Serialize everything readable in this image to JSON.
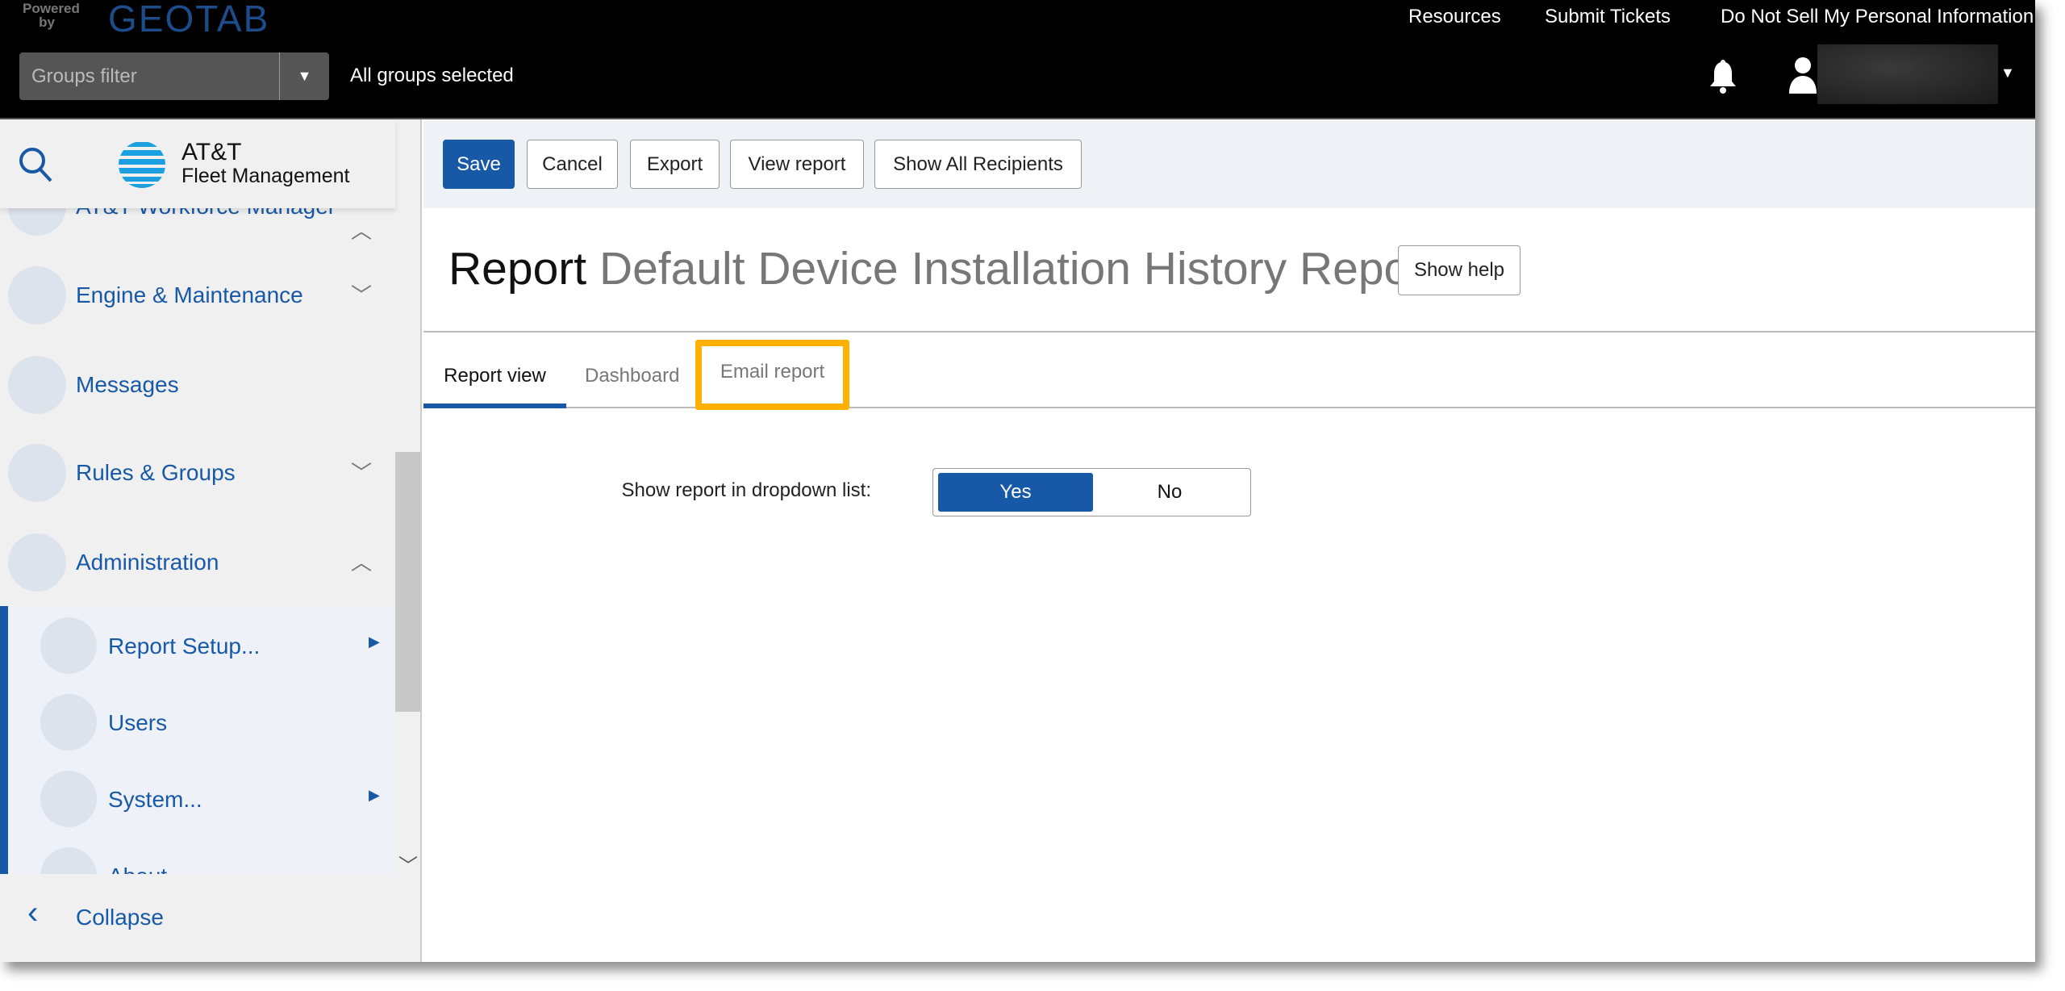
{
  "header": {
    "powered_by": "Powered by",
    "brand": "GEOTAB",
    "groups_filter_placeholder": "Groups filter",
    "groups_status": "All groups selected",
    "links": [
      "Resources",
      "Submit Tickets",
      "Do Not Sell My Personal Information"
    ]
  },
  "sidebar": {
    "logo_line1": "AT&T",
    "logo_line2": "Fleet Management",
    "items": [
      {
        "label": "AT&T Workforce Manager",
        "icon": "workforce-icon"
      },
      {
        "label": "Engine & Maintenance",
        "icon": "engine-icon"
      },
      {
        "label": "Messages",
        "icon": "envelope-icon"
      },
      {
        "label": "Rules & Groups",
        "icon": "rules-icon"
      },
      {
        "label": "Administration",
        "icon": "gear-icon"
      }
    ],
    "subitems": [
      {
        "label": "Report Setup...",
        "icon": "report-setup-icon"
      },
      {
        "label": "Users",
        "icon": "user-icon"
      },
      {
        "label": "System...",
        "icon": "system-icon"
      },
      {
        "label": "About",
        "icon": "info-icon"
      }
    ],
    "collapse": "Collapse"
  },
  "toolbar": {
    "save": "Save",
    "cancel": "Cancel",
    "export": "Export",
    "view_report": "View report",
    "show_all_recipients": "Show All Recipients"
  },
  "page": {
    "title_prefix": "Report",
    "title": "Default Device Installation History Report",
    "show_help": "Show help"
  },
  "tabs": [
    {
      "label": "Report view",
      "active": true
    },
    {
      "label": "Dashboard"
    },
    {
      "label": "Email report",
      "highlighted": true
    }
  ],
  "form": {
    "label": "Show report in dropdown list:",
    "yes": "Yes",
    "no": "No",
    "selected": "Yes"
  },
  "colors": {
    "accent": "#1859a7",
    "highlight": "#FFB000"
  }
}
